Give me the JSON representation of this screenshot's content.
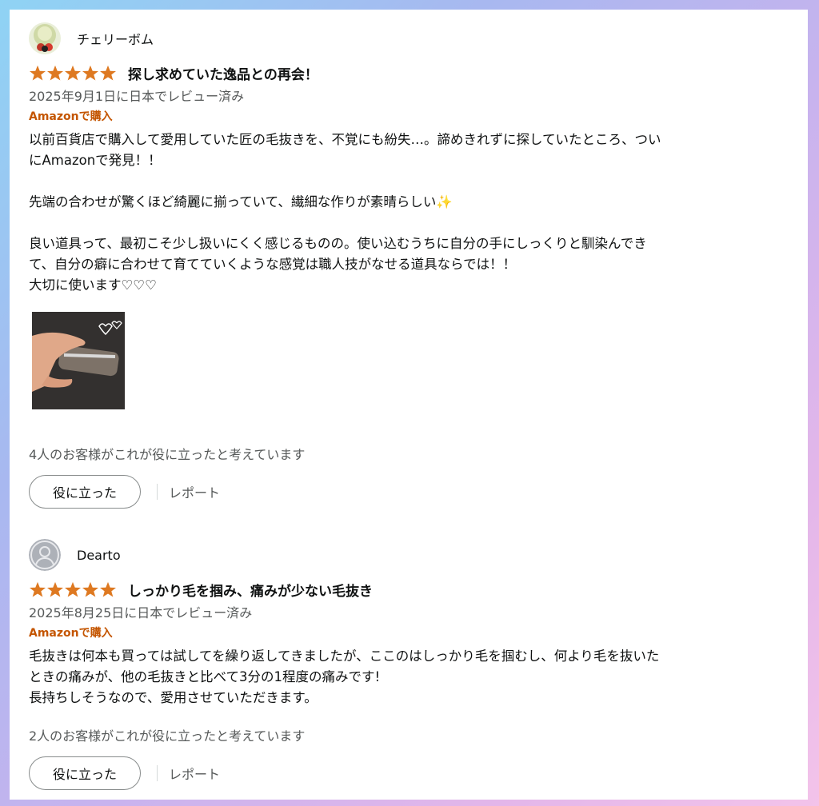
{
  "reviews": [
    {
      "reviewer": "チェリーボム",
      "avatar_icon": "cherry-avatar-icon",
      "rating": 5,
      "title": "探し求めていた逸品との再会！",
      "date": "2025年9月1日に日本でレビュー済み",
      "verified": "Amazonで購入",
      "body": [
        "以前百貨店で購入して愛用していた匠の毛抜きを、不覚にも紛失…。諦めきれずに探していたところ、つい",
        "にAmazonで発見！！",
        "",
        "先端の合わせが驚くほど綺麗に揃っていて、繊細な作りが素晴らしい✨",
        "",
        "良い道具って、最初こそ少し扱いにくく感じるものの。使い込むうちに自分の手にしっくりと馴染んでき",
        "て、自分の癖に合わせて育てていくような感覚は職人技がなせる道具ならでは！！",
        "大切に使います♡♡♡"
      ],
      "has_photo": true,
      "helpful_text": "4人のお客様がこれが役に立ったと考えています",
      "helpful_button": "役に立った",
      "report": "レポート"
    },
    {
      "reviewer": "Dearto",
      "avatar_icon": "default-user-avatar-icon",
      "rating": 5,
      "title": "しっかり毛を掴み、痛みが少ない毛抜き",
      "date": "2025年8月25日に日本でレビュー済み",
      "verified": "Amazonで購入",
      "body": [
        "毛抜きは何本も買っては試してを繰り返してきましたが、ここのはしっかり毛を掴むし、何より毛を抜いた",
        "ときの痛みが、他の毛抜きと比べて3分の1程度の痛みです!",
        "長持ちしそうなので、愛用させていただきます。"
      ],
      "has_photo": false,
      "helpful_text": "2人のお客様がこれが役に立ったと考えています",
      "helpful_button": "役に立った",
      "report": "レポート"
    }
  ],
  "colors": {
    "star": "#de7921",
    "verified": "#c45500",
    "muted": "#565959",
    "text": "#0f1111"
  }
}
